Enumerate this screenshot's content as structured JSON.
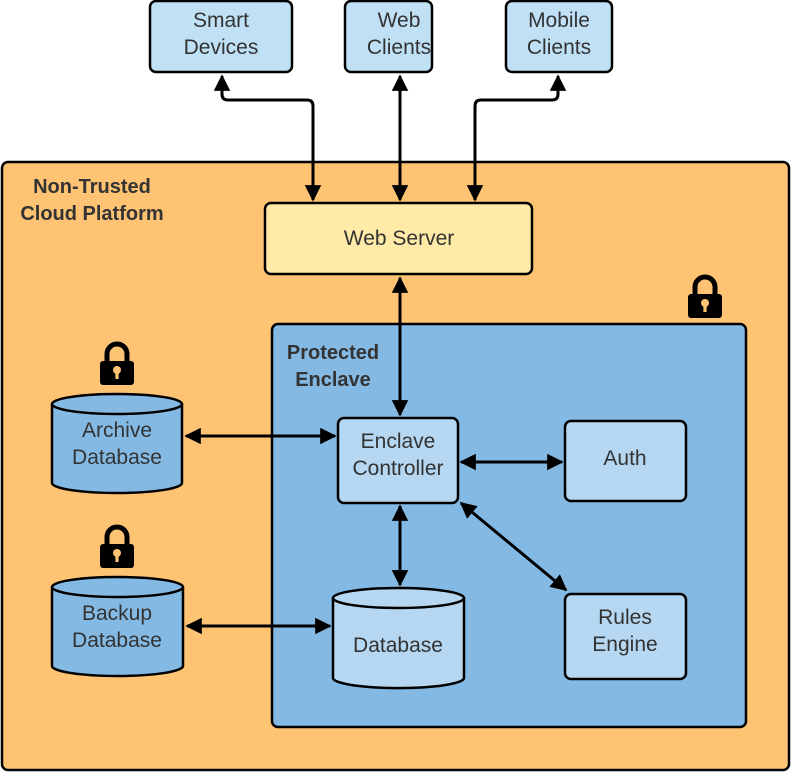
{
  "colors": {
    "platform": "#FFC374",
    "enclave": "#83B9E3",
    "node_light": "#B5D7F1",
    "client": "#BFE0F5",
    "web_server": "#FFEAA7",
    "stroke": "#000000"
  },
  "clients": [
    {
      "line1": "Smart",
      "line2": "Devices"
    },
    {
      "line1": "Web",
      "line2": "Clients"
    },
    {
      "line1": "Mobile",
      "line2": "Clients"
    }
  ],
  "platform": {
    "line1": "Non-Trusted",
    "line2": "Cloud Platform"
  },
  "web_server": {
    "label": "Web Server"
  },
  "enclave": {
    "line1": "Protected",
    "line2": "Enclave",
    "icon": "lock-icon"
  },
  "archive_db": {
    "line1": "Archive",
    "line2": "Database",
    "icon": "lock-icon"
  },
  "backup_db": {
    "line1": "Backup",
    "line2": "Database",
    "icon": "lock-icon"
  },
  "controller": {
    "line1": "Enclave",
    "line2": "Controller"
  },
  "auth": {
    "label": "Auth"
  },
  "rules": {
    "line1": "Rules",
    "line2": "Engine"
  },
  "database": {
    "label": "Database"
  }
}
